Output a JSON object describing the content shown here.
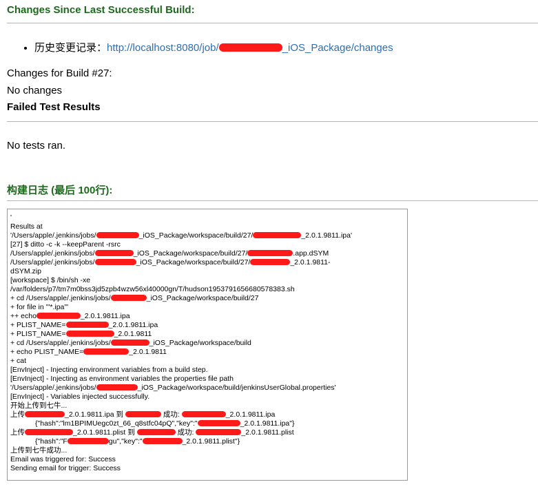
{
  "changes_heading": "Changes Since Last Successful Build:",
  "history": {
    "label": "历史变更记录：",
    "link_prefix": "http://localhost:8080/job/",
    "link_suffix": "_iOS_Package/changes"
  },
  "build_changes_title": "Changes for Build #27:",
  "no_changes": "No changes",
  "failed_tests_heading": "Failed Test Results",
  "no_tests": "No tests ran.",
  "log_heading": "构建日志 (最后 100行):",
  "log_lines": [
    "'",
    "Results at",
    "'/Users/apple/.jenkins/jobs/[R]_iOS_Package/workspace/build/27/[R]_2.0.1.9811.ipa'",
    "[27] $ ditto -c -k --keepParent -rsrc",
    "/Users/apple/.jenkins/jobs/[R]_iOS_Package/workspace/build/27/[R].app.dSYM",
    "/Users/apple/.jenkins/jobs/[R]_iOS_Package/workspace/build/27/[R]_2.0.1.9811-",
    "dSYM.zip",
    "[workspace] $ /bin/sh -xe",
    "/var/folders/p7/tm7m0bss3jd5zpb4wzw56xl40000gn/T/hudson1953791656680578383.sh",
    "+ cd /Users/apple/.jenkins/jobs/[R]_iOS_Package/workspace/build/27",
    "+ for file in '\"*.ipa\"'",
    "++ echo[R]_2.0.1.9811.ipa",
    "+ PLIST_NAME=[R]_2.0.1.9811.ipa",
    "+ PLIST_NAME=[R]_2.0.1.9811",
    "+ cd /Users/apple/.jenkins/jobs/[R]_iOS_Package/workspace/build",
    "+ echo PLIST_NAME=[R]_2.0.1.9811",
    "+ cat",
    "[EnvInject] - Injecting environment variables from a build step.",
    "[EnvInject] - Injecting as environment variables the properties file path",
    "'/Users/apple/.jenkins/jobs/[R]_iOS_Package/workspace/build/jenkinsUserGlobal.properties'",
    "[EnvInject] - Variables injected successfully.",
    "开始上传到七牛...",
    "上传[R]_2.0.1.9811.ipa 到 [R] 成功: [R]_2.0.1.9811.ipa",
    "{\"hash\":\"lm1BPIMUegc0zt_66_q8stfc04pQ\",\"key\":\"[R]_2.0.1.9811.ipa\"}",
    "上传[R]_2.0.1.9811.plist 到 [R] 成功: [R]_2.0.1.9811.plist",
    "{\"hash\":\"F[R]gu\",\"key\":\"[R]_2.0.1.9811.plist\"}",
    "上传到七牛成功...",
    "Email was triggered for: Success",
    "Sending email for trigger: Success"
  ],
  "indented_lines": [
    23,
    25
  ],
  "colors": {
    "heading": "#1d6a1d",
    "link": "#2a6ebb",
    "redaction": "#ff1a1a",
    "rule": "#b5b5b5"
  }
}
